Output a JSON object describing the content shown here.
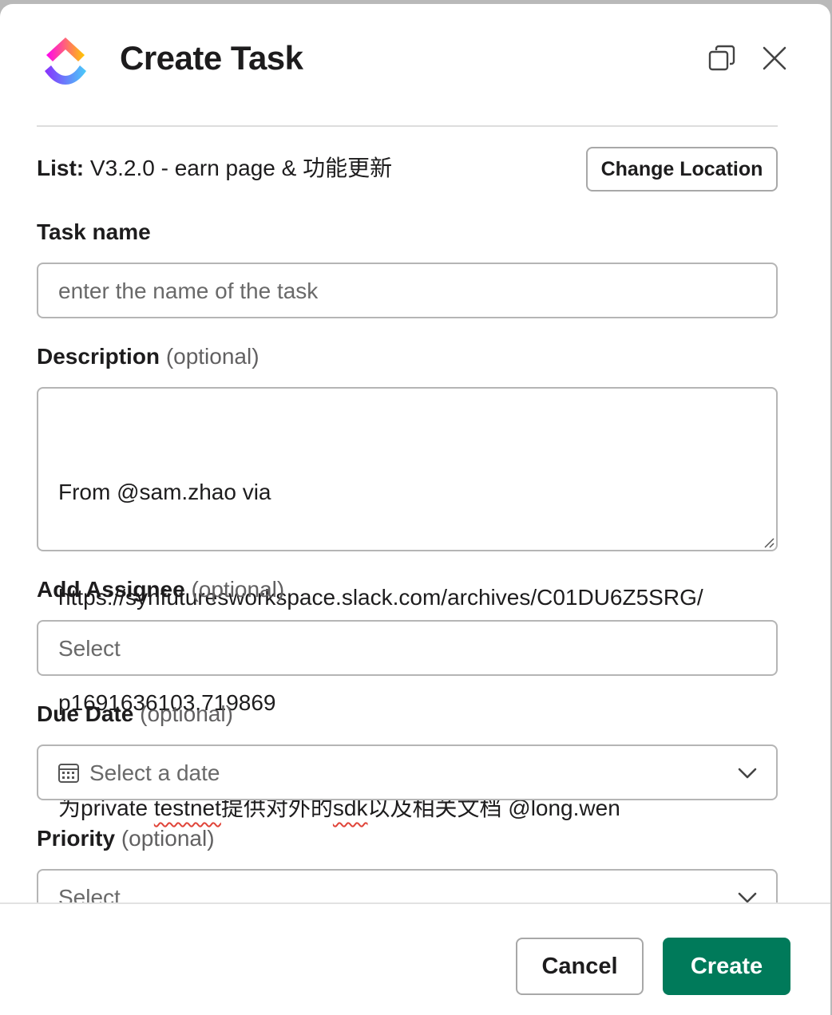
{
  "modal": {
    "title": "Create Task"
  },
  "location": {
    "prefix": "List:",
    "value": "V3.2.0 - earn page & 功能更新",
    "change_label": "Change Location"
  },
  "task_name": {
    "label": "Task name",
    "placeholder": "enter the name of the task",
    "value": ""
  },
  "description": {
    "label": "Description",
    "optional": "(optional)",
    "lines": [
      "From @sam.zhao via",
      "https://synfuturesworkspace.slack.com/archives/C01DU6Z5SRG/",
      "p1691636103.719869"
    ],
    "line4_a": "为private ",
    "line4_b": "testnet",
    "line4_c": "提供对外的",
    "line4_d": "sdk",
    "line4_e": "以及相关文档 @long.wen"
  },
  "assignee": {
    "label": "Add Assignee",
    "optional": "(optional)",
    "placeholder": "Select"
  },
  "due_date": {
    "label": "Due Date",
    "optional": "(optional)",
    "placeholder": "Select a date"
  },
  "priority": {
    "label": "Priority",
    "optional": "(optional)",
    "placeholder": "Select"
  },
  "footer": {
    "cancel_label": "Cancel",
    "create_label": "Create"
  },
  "colors": {
    "primary_button": "#007a5a",
    "spellcheck": "#e0453a"
  },
  "icons": {
    "logo": "clickup-logo-icon",
    "popout": "popout-window-icon",
    "close": "close-icon",
    "calendar": "calendar-icon",
    "chevron": "chevron-down-icon",
    "resize": "resize-grip-icon"
  }
}
